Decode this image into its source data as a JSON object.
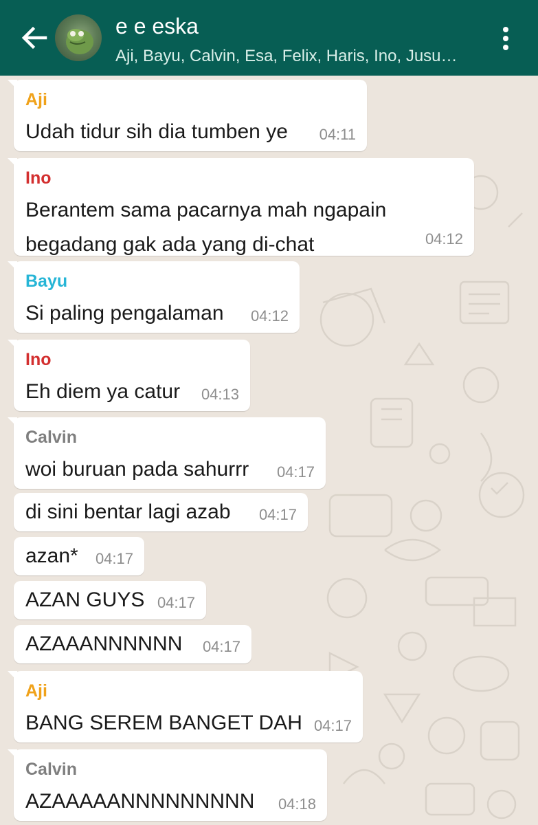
{
  "header": {
    "title": "e e eska",
    "subtitle": "Aji, Bayu, Calvin, Esa, Felix, Haris, Ino, Jusu…",
    "colors": {
      "bar": "#075e54",
      "background": "#ece5dd"
    },
    "icons": {
      "back": "arrow-left-icon",
      "more": "more-vertical-icon"
    }
  },
  "messages": [
    {
      "sender": "Aji",
      "sender_color": "#f0a21a",
      "lines": [
        "Udah tidur sih dia tumben ye"
      ],
      "time": "04:11"
    },
    {
      "sender": "Ino",
      "sender_color": "#d32f2f",
      "lines": [
        "Berantem sama pacarnya mah ngapain",
        "begadang gak ada yang di-chat"
      ],
      "time": "04:12"
    },
    {
      "sender": "Bayu",
      "sender_color": "#26b5d6",
      "lines": [
        "Si paling pengalaman"
      ],
      "time": "04:12"
    },
    {
      "sender": "Ino",
      "sender_color": "#d32f2f",
      "lines": [
        "Eh diem ya catur"
      ],
      "time": "04:13"
    },
    {
      "sender": "Calvin",
      "sender_color": "#7f7f7f",
      "lines": [
        "woi buruan pada sahurrr"
      ],
      "time": "04:17"
    },
    {
      "sender": "",
      "lines": [
        "di sini bentar lagi azab"
      ],
      "time": "04:17"
    },
    {
      "sender": "",
      "lines": [
        "azan*"
      ],
      "time": "04:17"
    },
    {
      "sender": "",
      "lines": [
        "AZAN GUYS"
      ],
      "time": "04:17"
    },
    {
      "sender": "",
      "lines": [
        "AZAAANNNNNN"
      ],
      "time": "04:17"
    },
    {
      "sender": "Aji",
      "sender_color": "#f0a21a",
      "lines": [
        "BANG SEREM BANGET DAH"
      ],
      "time": "04:17"
    },
    {
      "sender": "Calvin",
      "sender_color": "#7f7f7f",
      "lines": [
        "AZAAAAANNNNNNNNN"
      ],
      "time": "04:18"
    }
  ]
}
